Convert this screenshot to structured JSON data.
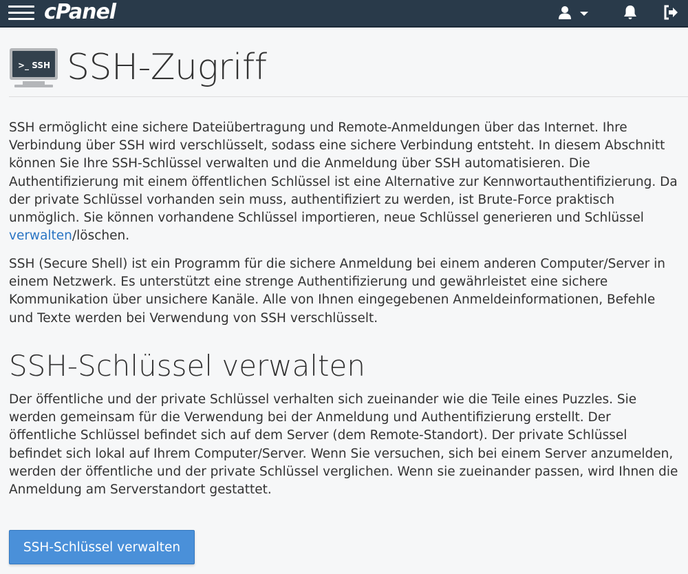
{
  "topbar": {
    "logo": "cPanel",
    "icons": [
      "menu-icon",
      "user-icon",
      "chevron-down-icon",
      "bell-icon",
      "logout-icon"
    ]
  },
  "page": {
    "icon_label": ">_ SSH",
    "title": "SSH-Zugriff",
    "intro_before_link": "SSH ermöglicht eine sichere Dateiübertragung und Remote-Anmeldungen über das Internet. Ihre Verbindung über SSH wird verschlüsselt, sodass eine sichere Verbindung entsteht. In diesem Abschnitt können Sie Ihre SSH-Schlüssel verwalten und die Anmeldung über SSH automatisieren. Die Authentifizierung mit einem öffentlichen Schlüssel ist eine Alternative zur Kennwortauthentifizierung. Da der private Schlüssel vorhanden sein muss, authentifiziert zu werden, ist Brute-Force praktisch unmöglich. Sie können vorhandene Schlüssel importieren, neue Schlüssel generieren und Schlüssel ",
    "intro_link": "verwalten",
    "intro_after_link": "/löschen.",
    "ssh_description": "SSH (Secure Shell) ist ein Programm für die sichere Anmeldung bei einem anderen Computer/Server in einem Netzwerk. Es unterstützt eine strenge Authentifizierung und gewährleistet eine sichere Kommunikation über unsichere Kanäle. Alle von Ihnen eingegebenen Anmeldeinformationen, Befehle und Texte werden bei Verwendung von SSH verschlüsselt.",
    "section_title": "SSH-Schlüssel verwalten",
    "section_text": "Der öffentliche und der private Schlüssel verhalten sich zueinander wie die Teile eines Puzzles. Sie werden gemeinsam für die Verwendung bei der Anmeldung und Authentifizierung erstellt. Der öffentliche Schlüssel befindet sich auf dem Server (dem Remote-Standort). Der private Schlüssel befindet sich lokal auf Ihrem Computer/Server. Wenn Sie versuchen, sich bei einem Server anzumelden, werden der öffentliche und der private Schlüssel verglichen. Wenn sie zueinander passen, wird Ihnen die Anmeldung am Serverstandort gestattet.",
    "button_label": "SSH-Schlüssel verwalten"
  },
  "colors": {
    "topbar": "#293a4a",
    "link": "#2a75c4",
    "button": "#4a90d9"
  }
}
